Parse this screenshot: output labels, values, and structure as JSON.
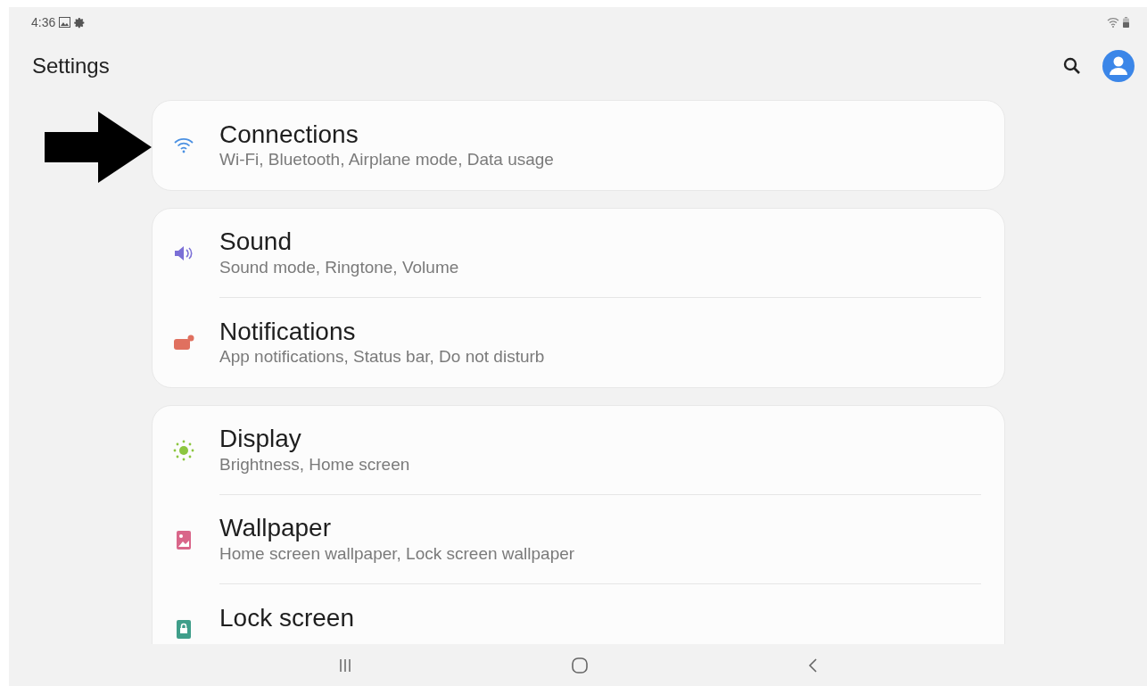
{
  "status_bar": {
    "time": "4:36"
  },
  "header": {
    "title": "Settings"
  },
  "groups": [
    {
      "items": [
        {
          "color": "#4a90e2",
          "title": "Connections",
          "subtitle": "Wi-Fi, Bluetooth, Airplane mode, Data usage"
        }
      ]
    },
    {
      "items": [
        {
          "color": "#7b6fd6",
          "title": "Sound",
          "subtitle": "Sound mode, Ringtone, Volume"
        },
        {
          "color": "#e0705f",
          "title": "Notifications",
          "subtitle": "App notifications, Status bar, Do not disturb"
        }
      ]
    },
    {
      "items": [
        {
          "color": "#8cc63f",
          "title": "Display",
          "subtitle": "Brightness, Home screen"
        },
        {
          "color": "#d9668a",
          "title": "Wallpaper",
          "subtitle": "Home screen wallpaper, Lock screen wallpaper"
        },
        {
          "color": "#3f9e8a",
          "title": "Lock screen"
        }
      ]
    }
  ]
}
